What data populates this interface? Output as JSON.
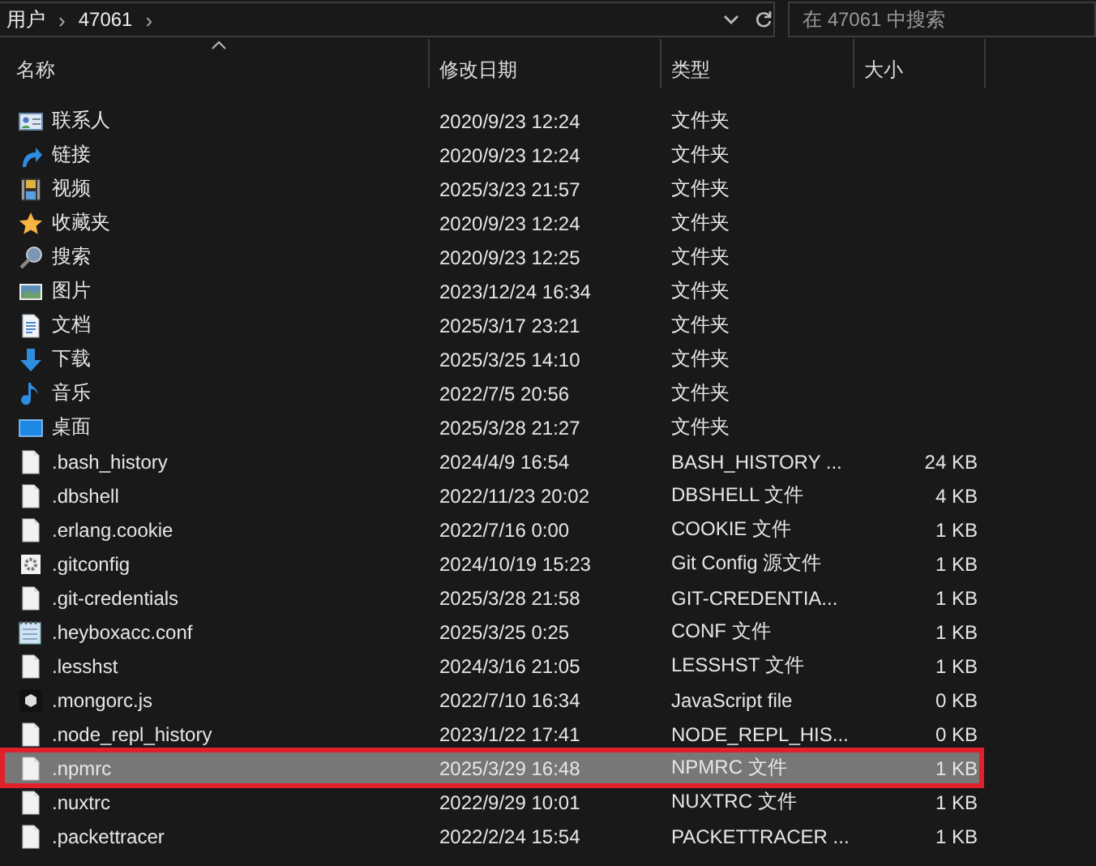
{
  "address_bar": {
    "crumbs": [
      "用户",
      "47061"
    ],
    "separator": "›"
  },
  "search": {
    "placeholder": "在 47061 中搜索"
  },
  "columns": [
    {
      "label": "名称",
      "sorted": true
    },
    {
      "label": "修改日期",
      "sorted": false
    },
    {
      "label": "类型",
      "sorted": false
    },
    {
      "label": "大小",
      "sorted": false
    }
  ],
  "rows": [
    {
      "kind": "contacts",
      "name": "联系人",
      "date": "2020/9/23 12:24",
      "type": "文件夹",
      "size": "",
      "selected": false
    },
    {
      "kind": "links",
      "name": "链接",
      "date": "2020/9/23 12:24",
      "type": "文件夹",
      "size": "",
      "selected": false
    },
    {
      "kind": "videos",
      "name": "视频",
      "date": "2025/3/23 21:57",
      "type": "文件夹",
      "size": "",
      "selected": false
    },
    {
      "kind": "favorites",
      "name": "收藏夹",
      "date": "2020/9/23 12:24",
      "type": "文件夹",
      "size": "",
      "selected": false
    },
    {
      "kind": "searches",
      "name": "搜索",
      "date": "2020/9/23 12:25",
      "type": "文件夹",
      "size": "",
      "selected": false
    },
    {
      "kind": "pictures",
      "name": "图片",
      "date": "2023/12/24 16:34",
      "type": "文件夹",
      "size": "",
      "selected": false
    },
    {
      "kind": "documents",
      "name": "文档",
      "date": "2025/3/17 23:21",
      "type": "文件夹",
      "size": "",
      "selected": false
    },
    {
      "kind": "downloads",
      "name": "下载",
      "date": "2025/3/25 14:10",
      "type": "文件夹",
      "size": "",
      "selected": false
    },
    {
      "kind": "music",
      "name": "音乐",
      "date": "2022/7/5 20:56",
      "type": "文件夹",
      "size": "",
      "selected": false
    },
    {
      "kind": "desktop",
      "name": "桌面",
      "date": "2025/3/28 21:27",
      "type": "文件夹",
      "size": "",
      "selected": false
    },
    {
      "kind": "file",
      "name": ".bash_history",
      "date": "2024/4/9 16:54",
      "type": "BASH_HISTORY ...",
      "size": "24 KB",
      "selected": false
    },
    {
      "kind": "file",
      "name": ".dbshell",
      "date": "2022/11/23 20:02",
      "type": "DBSHELL 文件",
      "size": "4 KB",
      "selected": false
    },
    {
      "kind": "file",
      "name": ".erlang.cookie",
      "date": "2022/7/16 0:00",
      "type": "COOKIE 文件",
      "size": "1 KB",
      "selected": false
    },
    {
      "kind": "config",
      "name": ".gitconfig",
      "date": "2024/10/19 15:23",
      "type": "Git Config 源文件",
      "size": "1 KB",
      "selected": false
    },
    {
      "kind": "file",
      "name": ".git-credentials",
      "date": "2025/3/28 21:58",
      "type": "GIT-CREDENTIA...",
      "size": "1 KB",
      "selected": false
    },
    {
      "kind": "notes",
      "name": ".heyboxacc.conf",
      "date": "2025/3/25 0:25",
      "type": "CONF 文件",
      "size": "1 KB",
      "selected": false
    },
    {
      "kind": "file",
      "name": ".lesshst",
      "date": "2024/3/16 21:05",
      "type": "LESSHST 文件",
      "size": "1 KB",
      "selected": false
    },
    {
      "kind": "script",
      "name": ".mongorc.js",
      "date": "2022/7/10 16:34",
      "type": "JavaScript file",
      "size": "0 KB",
      "selected": false
    },
    {
      "kind": "file",
      "name": ".node_repl_history",
      "date": "2023/1/22 17:41",
      "type": "NODE_REPL_HIS...",
      "size": "0 KB",
      "selected": false
    },
    {
      "kind": "file",
      "name": ".npmrc",
      "date": "2025/3/29 16:48",
      "type": "NPMRC 文件",
      "size": "1 KB",
      "selected": true
    },
    {
      "kind": "file",
      "name": ".nuxtrc",
      "date": "2022/9/29 10:01",
      "type": "NUXTRC 文件",
      "size": "1 KB",
      "selected": false
    },
    {
      "kind": "file",
      "name": ".packettracer",
      "date": "2022/2/24 15:54",
      "type": "PACKETTRACER ...",
      "size": "1 KB",
      "selected": false
    }
  ]
}
